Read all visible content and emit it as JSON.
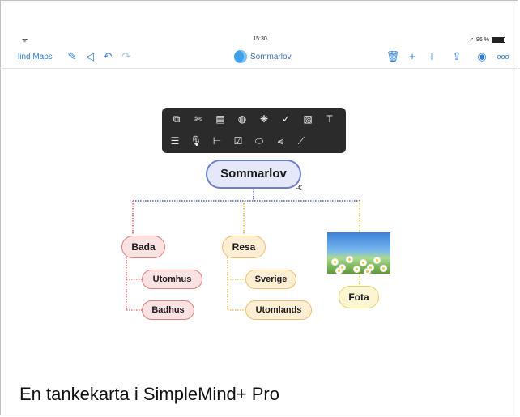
{
  "status_bar": {
    "wifi": "ᯤ",
    "time": "15:30",
    "location_glyph": "➶",
    "battery_text": "96 %",
    "battery_level": 0.96
  },
  "nav": {
    "back_label": "lind Maps",
    "title": "Sommarlov"
  },
  "toolbox": {
    "row1": [
      {
        "icon": "copy-icon",
        "glyph": "⧉"
      },
      {
        "icon": "cut-icon",
        "glyph": "✄"
      },
      {
        "icon": "clipboard-icon",
        "glyph": "▤"
      },
      {
        "icon": "palette-icon",
        "glyph": "◍"
      },
      {
        "icon": "style-icon",
        "glyph": "❋"
      },
      {
        "icon": "checkmark-icon",
        "glyph": "✓"
      },
      {
        "icon": "image-icon",
        "glyph": "▨"
      },
      {
        "icon": "text-add-icon",
        "glyph": "T"
      }
    ],
    "row2": [
      {
        "icon": "layout-icon",
        "glyph": "☰"
      },
      {
        "icon": "microphone-icon",
        "glyph": "🎙"
      },
      {
        "icon": "hierarchy-icon",
        "glyph": "⊢"
      },
      {
        "icon": "checkbox-icon",
        "glyph": "☑"
      },
      {
        "icon": "shape-icon",
        "glyph": "⬭"
      },
      {
        "icon": "share-icon",
        "glyph": "⪪"
      },
      {
        "icon": "line-icon",
        "glyph": "⟋"
      }
    ]
  },
  "mindmap": {
    "central": "Sommarlov",
    "collapse_mark": "-€",
    "branches": [
      {
        "label": "Bada",
        "color": "#e77a7a",
        "children": [
          "Utomhus",
          "Badhus"
        ]
      },
      {
        "label": "Resa",
        "color": "#f0bf6a",
        "children": [
          "Sverige",
          "Utomlands"
        ]
      },
      {
        "label": "Fota",
        "color": "#e8d06c",
        "children": []
      }
    ],
    "main_line_color": "#6d7fc8"
  },
  "caption": "En tankekarta i SimpleMind+ Pro"
}
